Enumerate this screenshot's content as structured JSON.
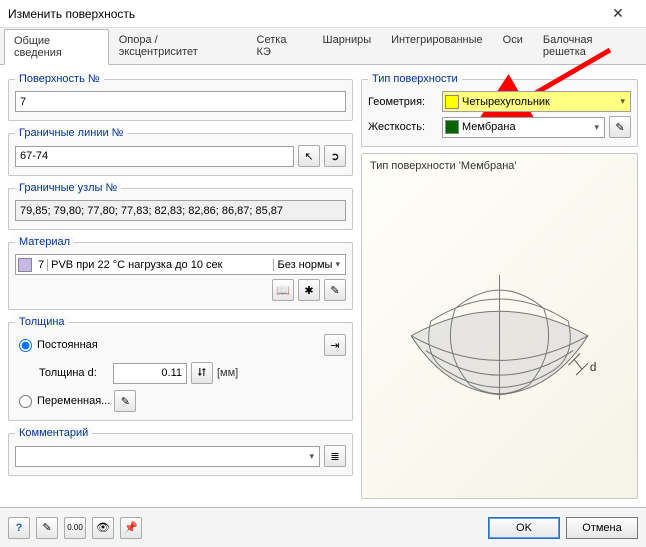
{
  "window": {
    "title": "Изменить поверхность"
  },
  "tabs": [
    "Общие сведения",
    "Опора / эксцентриситет",
    "Сетка КЭ",
    "Шарниры",
    "Интегрированные",
    "Оси",
    "Балочная решетка"
  ],
  "left": {
    "surface_no": {
      "legend": "Поверхность №",
      "value": "7"
    },
    "boundary_lines": {
      "legend": "Граничные линии №",
      "value": "67-74"
    },
    "boundary_nodes": {
      "legend": "Граничные узлы №",
      "value": "79,85; 79,80; 77,80; 77,83; 82,83; 82,86; 86,87; 85,87"
    },
    "material": {
      "legend": "Материал",
      "index": "7",
      "name": "PVB при 22 °C нагрузка до 10 сек",
      "norm": "Без нормы"
    },
    "thickness": {
      "legend": "Толщина",
      "constant_label": "Постоянная",
      "d_label": "Толщина d:",
      "d_value": "0.11",
      "d_unit": "[мм]",
      "variable_label": "Переменная..."
    },
    "comment": {
      "legend": "Комментарий",
      "value": ""
    }
  },
  "right": {
    "type_legend": "Тип поверхности",
    "geometry_label": "Геометрия:",
    "geometry_value": "Четырехугольник",
    "geometry_swatch": "#ffff00",
    "stiffness_label": "Жесткость:",
    "stiffness_value": "Мембрана",
    "stiffness_swatch": "#006400",
    "preview_caption": "Тип поверхности 'Мембрана'",
    "preview_annotation": "d"
  },
  "footer": {
    "ok": "OK",
    "cancel": "Отмена"
  },
  "icons": {
    "close": "✕",
    "pick": "↖",
    "link": "➲",
    "book": "📖",
    "new": "✱",
    "edit": "✎",
    "export": "⇥",
    "stepper": "⮃",
    "dots": "…",
    "combo": "▾",
    "list": "≣",
    "help": "?",
    "note": "✎",
    "calc": "0.00",
    "eye": "👁",
    "pin": "📌"
  }
}
